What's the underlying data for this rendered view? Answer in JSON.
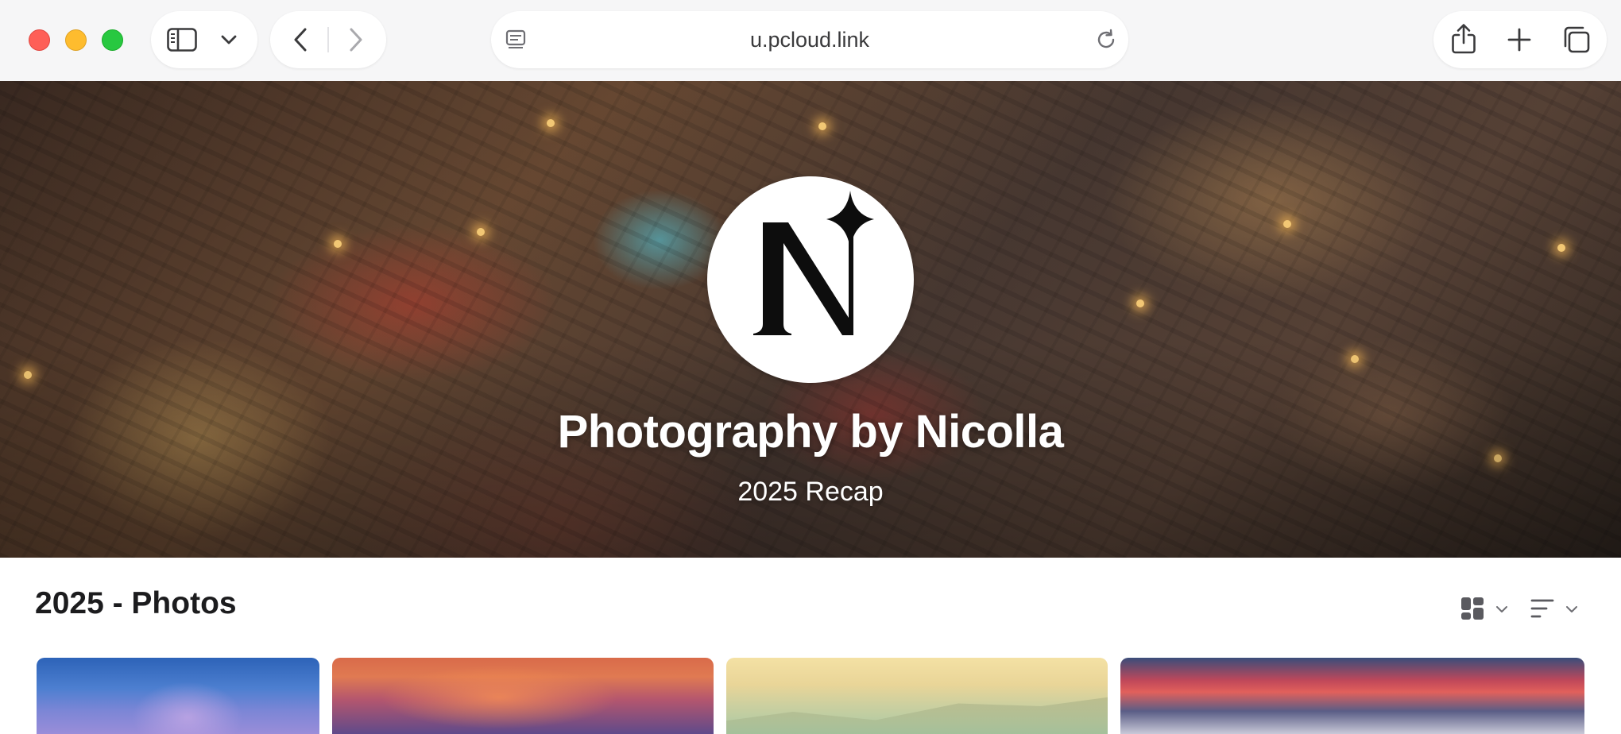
{
  "browser": {
    "address": "u.pcloud.link",
    "icons": {
      "sidebar": "sidebar-icon",
      "tab_overview_chevron": "chevron-down-icon",
      "back": "back-icon",
      "forward": "forward-icon",
      "page_menu": "page-menu-icon",
      "reload": "reload-icon",
      "share": "share-icon",
      "new_tab": "plus-icon",
      "tabs": "tabs-icon"
    },
    "traffic_lights": {
      "close": "#fe5f57",
      "minimize": "#febc2e",
      "maximize": "#28c840"
    }
  },
  "hero": {
    "logo_letter": "N",
    "title": "Photography by Nicolla",
    "subtitle": "2025 Recap"
  },
  "gallery": {
    "section_title": "2025 - Photos",
    "view_icon": "grid-view-icon",
    "sort_icon": "sort-icon",
    "photos": [
      {
        "name": "photo-1"
      },
      {
        "name": "photo-2"
      },
      {
        "name": "photo-3"
      },
      {
        "name": "photo-4"
      }
    ]
  }
}
